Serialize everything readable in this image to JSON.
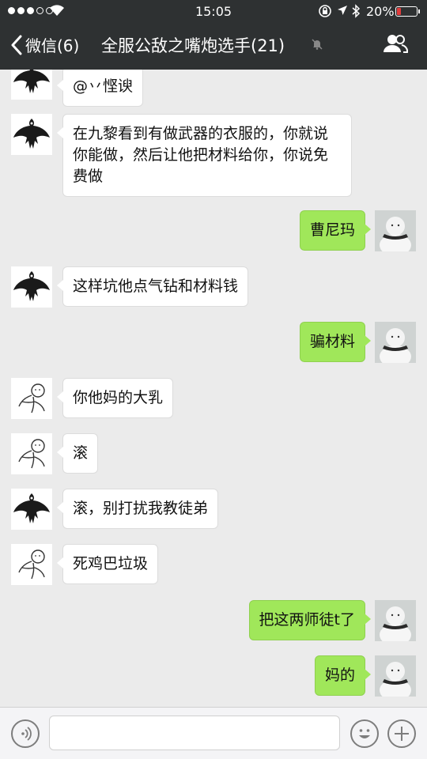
{
  "status_bar": {
    "time": "15:05",
    "battery": "20%",
    "battery_level": 0.2,
    "battery_color": "#e23c3c"
  },
  "nav": {
    "back_label": "微信(6)",
    "title": "全服公敌之嘴炮选手(21)"
  },
  "colors": {
    "nav_bg": "#2e3132",
    "chat_bg": "#ebebeb",
    "outgoing_bubble": "#a0e75a",
    "incoming_bubble": "#ffffff"
  },
  "messages": [
    {
      "side": "in",
      "avatar": "dark-bird-avatar",
      "text": "@丷悭谀"
    },
    {
      "side": "in",
      "avatar": "dark-bird-avatar",
      "text": "在九黎看到有做武器的衣服的，你就说你能做，然后让他把材料给你，你说免费做"
    },
    {
      "side": "out",
      "avatar": "snowman-avatar",
      "text": "曹尼玛"
    },
    {
      "side": "in",
      "avatar": "dark-bird-avatar",
      "text": "这样坑他点气钻和材料钱"
    },
    {
      "side": "out",
      "avatar": "snowman-avatar",
      "text": "骗材料"
    },
    {
      "side": "in",
      "avatar": "sketch-figure-avatar",
      "text": "你他妈的大乳"
    },
    {
      "side": "in",
      "avatar": "sketch-figure-avatar",
      "text": "滚"
    },
    {
      "side": "in",
      "avatar": "dark-bird-avatar",
      "text": "滚，别打扰我教徒弟"
    },
    {
      "side": "in",
      "avatar": "sketch-figure-avatar",
      "text": "死鸡巴垃圾"
    },
    {
      "side": "out",
      "avatar": "snowman-avatar",
      "text": "把这两师徒t了"
    },
    {
      "side": "out",
      "avatar": "snowman-avatar",
      "text": "妈的"
    }
  ],
  "input": {
    "value": "",
    "placeholder": ""
  }
}
